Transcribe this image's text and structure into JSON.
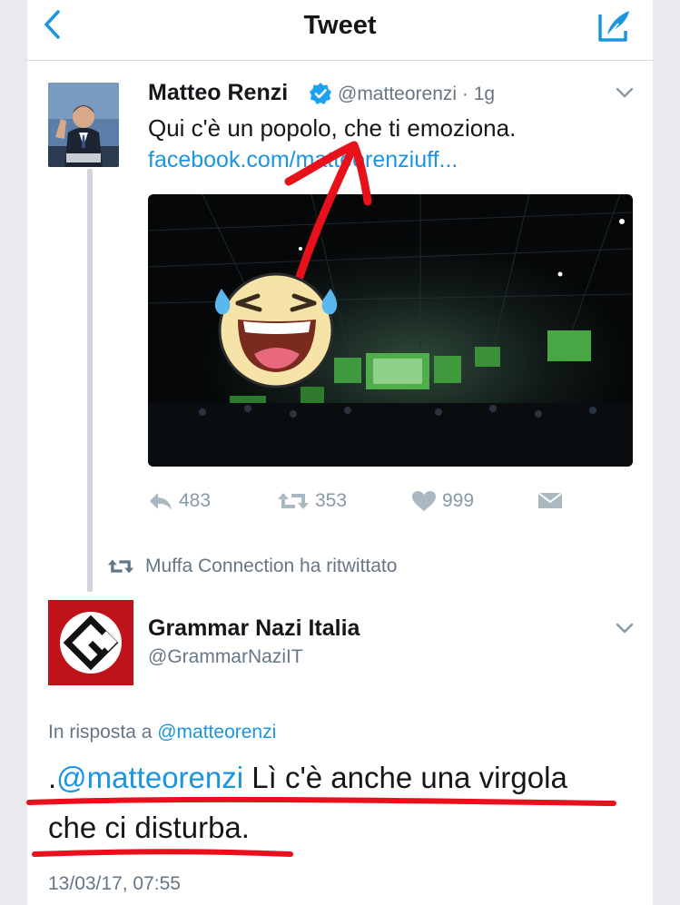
{
  "header": {
    "title": "Tweet"
  },
  "tweet": {
    "author_name": "Matteo Renzi",
    "author_handle": "@matteorenzi",
    "separator": " · ",
    "time_ago": "1g",
    "text": "Qui c'è un popolo, che ti emoziona.",
    "link": "facebook.com/matteorenziuff...",
    "stats": {
      "replies": "483",
      "retweets": "353",
      "likes": "999"
    }
  },
  "retweet_notice": "Muffa Connection ha ritwittato",
  "reply": {
    "author_name": "Grammar Nazi Italia",
    "author_handle": "@GrammarNaziIT",
    "in_reply_prefix": "In risposta a ",
    "in_reply_handle": "@matteorenzi",
    "text_prefix": ".",
    "text_mention": "@matteorenzi",
    "text_line1_rest": " Lì c'è anche una virgola",
    "text_line2": "che ci disturba.",
    "timestamp": "13/03/17, 07:55"
  },
  "colors": {
    "accent": "#1b95e0",
    "annotation_red": "#e8101b",
    "secondary_text": "#657786"
  },
  "icons": [
    "back-chevron-icon",
    "compose-icon",
    "verified-badge-icon",
    "chevron-down-icon",
    "reply-icon",
    "retweet-icon",
    "heart-icon",
    "message-icon",
    "grammar-nazi-logo",
    "laughing-emoji"
  ]
}
